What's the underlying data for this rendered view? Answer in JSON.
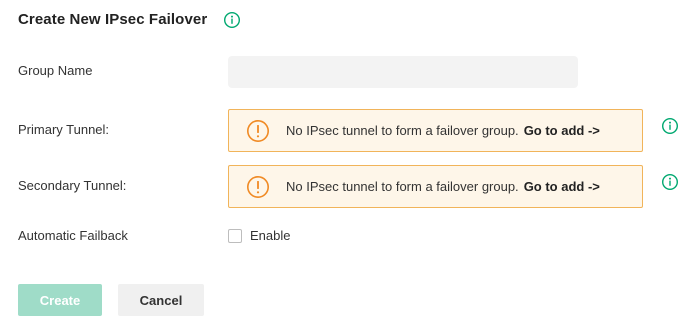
{
  "header": {
    "title": "Create New IPsec Failover"
  },
  "form": {
    "group_name": {
      "label": "Group Name",
      "value": "",
      "placeholder": ""
    },
    "primary_tunnel": {
      "label": "Primary Tunnel:",
      "warning": "No IPsec tunnel to form a failover group.",
      "link": "Go to add ->"
    },
    "secondary_tunnel": {
      "label": "Secondary Tunnel:",
      "warning": "No IPsec tunnel to form a failover group.",
      "link": "Go to add ->"
    },
    "automatic_failback": {
      "label": "Automatic Failback",
      "option_label": "Enable",
      "checked": false
    }
  },
  "actions": {
    "create_label": "Create",
    "cancel_label": "Cancel"
  },
  "icons": {
    "title_info": "info-icon",
    "tunnel_info": "info-icon",
    "warning": "warning-icon"
  },
  "colors": {
    "accent": "#00a870",
    "warning_border": "#f1b45a",
    "warning_background": "#fef6e9",
    "warning_icon": "#f08a24",
    "create_disabled": "#9fdcc8"
  }
}
